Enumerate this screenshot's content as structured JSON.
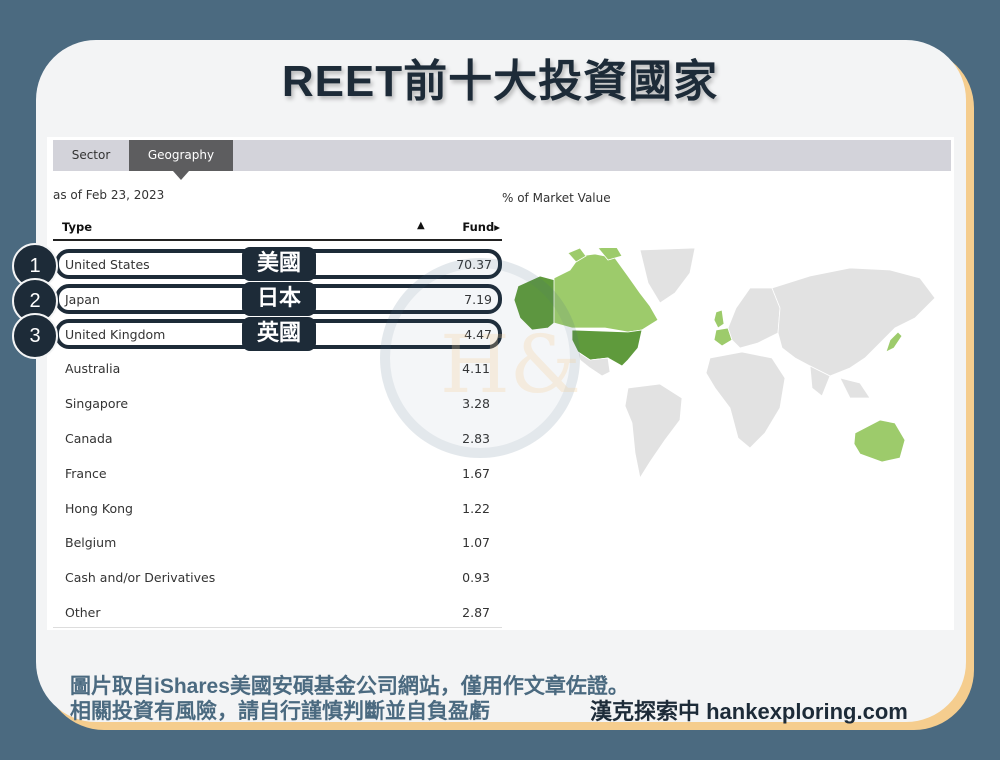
{
  "title": "REET前十大投資國家",
  "tabs": [
    {
      "label": "Sector",
      "active": false
    },
    {
      "label": "Geography",
      "active": true
    }
  ],
  "as_of": "as of Feb 23, 2023",
  "map_label": "% of Market Value",
  "table": {
    "columns": {
      "type": "Type",
      "sort_indicator": "▲",
      "fund": "Fund▸"
    },
    "rows": [
      {
        "name": "United States",
        "value": "70.37",
        "rank": "1",
        "tag": "美國"
      },
      {
        "name": "Japan",
        "value": "7.19",
        "rank": "2",
        "tag": "日本"
      },
      {
        "name": "United Kingdom",
        "value": "4.47",
        "rank": "3",
        "tag": "英國"
      },
      {
        "name": "Australia",
        "value": "4.11"
      },
      {
        "name": "Singapore",
        "value": "3.28"
      },
      {
        "name": "Canada",
        "value": "2.83"
      },
      {
        "name": "France",
        "value": "1.67"
      },
      {
        "name": "Hong Kong",
        "value": "1.22"
      },
      {
        "name": "Belgium",
        "value": "1.07"
      },
      {
        "name": "Cash and/or Derivatives",
        "value": "0.93"
      },
      {
        "name": "Other",
        "value": "2.87"
      }
    ]
  },
  "map_colors": {
    "dark": "#5f9a3c",
    "mid": "#7fb24f",
    "light": "#9dcb6b",
    "none": "#e2e2e2"
  },
  "colors": {
    "background": "#4b6a80",
    "card": "#f3f4f5",
    "card_accent": "#f5cd8e",
    "navy": "#1d2b38",
    "tab_active": "#5d5d5f",
    "tab_bar": "#d3d3da"
  },
  "watermark": "H&",
  "footer": {
    "line1": "圖片取自iShares美國安碩基金公司網站，僅用作文章佐證。",
    "line2": "相關投資有風險，請自行謹慎判斷並自負盈虧",
    "brand": "漢克探索中 hankexploring.com"
  }
}
